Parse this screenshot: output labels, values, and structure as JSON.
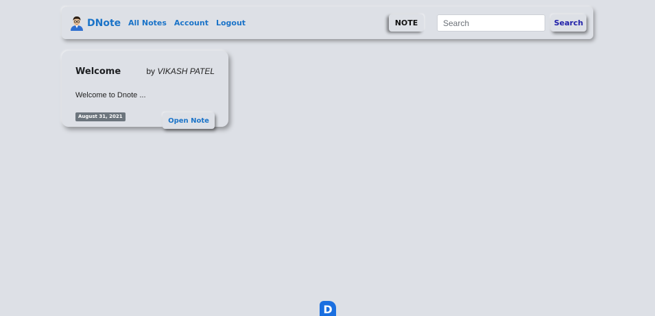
{
  "navbar": {
    "brand": {
      "name": "DNote",
      "avatar_icon": "user-avatar-icon"
    },
    "links": [
      {
        "label": "All Notes"
      },
      {
        "label": "Account"
      },
      {
        "label": "Logout"
      }
    ],
    "note_button_label": "NOTE",
    "search": {
      "placeholder": "Search",
      "value": "",
      "button_label": "Search"
    }
  },
  "notes": [
    {
      "title": "Welcome",
      "author_prefix": "by",
      "author": "VIKASH PATEL",
      "excerpt": "Welcome to Dnote ...",
      "date": "August 31, 2021",
      "open_label": "Open Note"
    }
  ],
  "footer": {
    "logo_letter": "D"
  },
  "colors": {
    "background": "#dde0e6",
    "link": "#1a73c8",
    "search_button_text": "#1d1da8",
    "badge": "#6c757d",
    "footer_logo": "#1a6fe0"
  }
}
